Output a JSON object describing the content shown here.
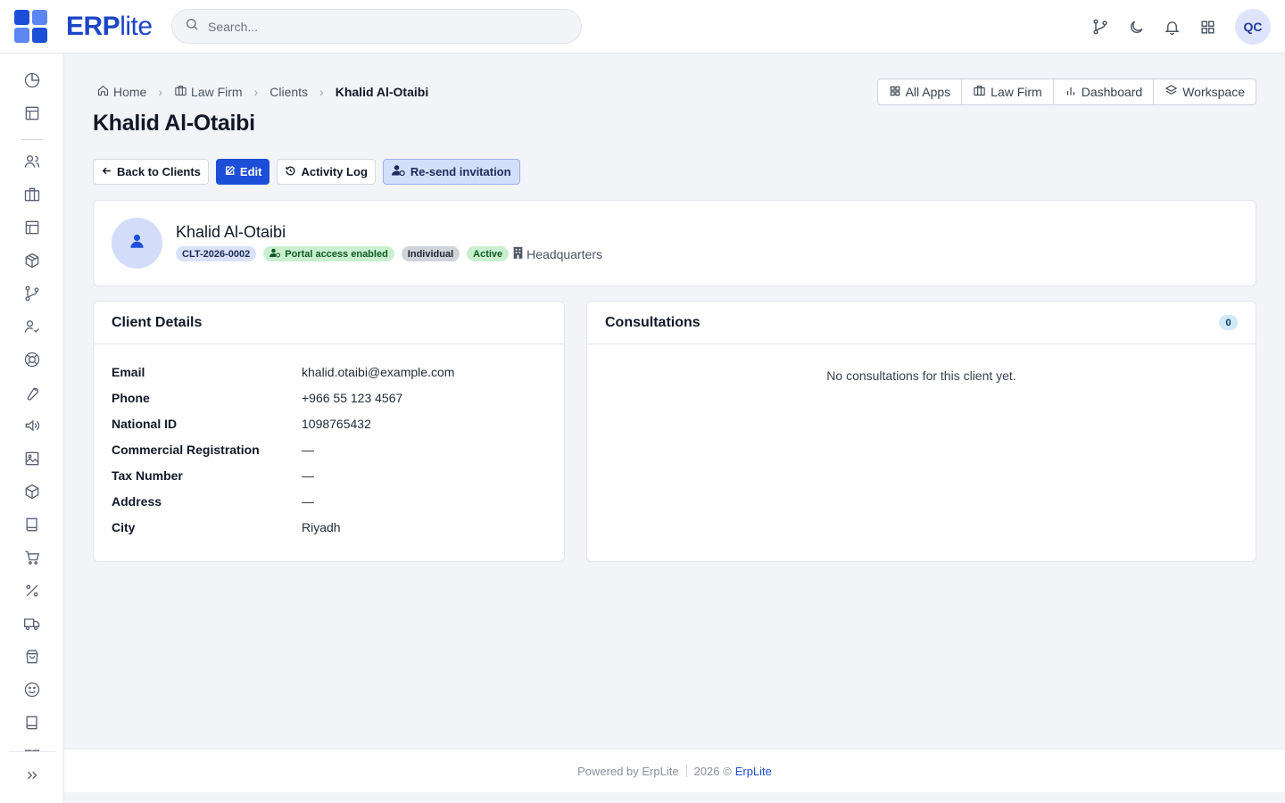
{
  "brand": {
    "bold": "ERP",
    "light": "lite",
    "colors": [
      "#1d4ed8",
      "#5c86f2",
      "#5c86f2",
      "#1d4ed8"
    ]
  },
  "search": {
    "placeholder": "Search..."
  },
  "topbar": {
    "avatar_initials": "QC",
    "icons": [
      "git-branch-icon",
      "moon-icon",
      "bell-icon",
      "apps-grid-icon"
    ]
  },
  "sidebar": {
    "icons": [
      "pie-chart-icon",
      "layout-icon",
      "users-icon",
      "briefcase-icon",
      "layout-icon",
      "package-icon",
      "git-branch-icon",
      "user-check-icon",
      "life-buoy-icon",
      "wrench-icon",
      "megaphone-icon",
      "image-icon",
      "box-icon",
      "book-icon",
      "cart-icon",
      "percent-icon",
      "truck-icon",
      "shopping-bag-icon",
      "smile-icon",
      "book-icon",
      "book-open-icon",
      "chevrons-right-icon"
    ]
  },
  "breadcrumb": {
    "home": "Home",
    "law_firm": "Law Firm",
    "clients": "Clients",
    "current": "Khalid Al-Otaibi"
  },
  "page": {
    "title": "Khalid Al-Otaibi"
  },
  "app_switch": {
    "all_apps": "All Apps",
    "law_firm": "Law Firm",
    "dashboard": "Dashboard",
    "workspace": "Workspace"
  },
  "actions": {
    "back": "Back to Clients",
    "edit": "Edit",
    "activity": "Activity Log",
    "resend": "Re-send invitation"
  },
  "profile": {
    "name": "Khalid Al-Otaibi",
    "code": "CLT-2026-0002",
    "portal": "Portal access enabled",
    "type": "Individual",
    "status": "Active",
    "branch": "Headquarters"
  },
  "details": {
    "title": "Client Details",
    "rows": [
      {
        "label": "Email",
        "value": "khalid.otaibi@example.com"
      },
      {
        "label": "Phone",
        "value": "+966 55 123 4567"
      },
      {
        "label": "National ID",
        "value": "1098765432"
      },
      {
        "label": "Commercial Registration",
        "value": "—"
      },
      {
        "label": "Tax Number",
        "value": "—"
      },
      {
        "label": "Address",
        "value": "—"
      },
      {
        "label": "City",
        "value": "Riyadh"
      }
    ]
  },
  "consultations": {
    "title": "Consultations",
    "count": "0",
    "empty": "No consultations for this client yet."
  },
  "footer": {
    "powered": "Powered by ErpLite",
    "year": "2026 ©",
    "link": "ErpLite"
  }
}
